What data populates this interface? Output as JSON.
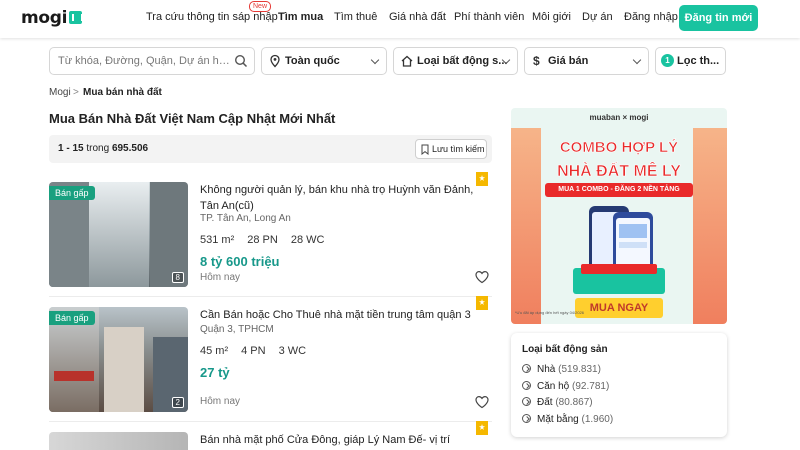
{
  "header": {
    "logo": "mogi",
    "nav": [
      {
        "label": "Tra cứu thông tin sáp nhập"
      },
      {
        "label": "Tìm mua"
      },
      {
        "label": "Tìm thuê"
      },
      {
        "label": "Giá nhà đất"
      },
      {
        "label": "Phí thành viên"
      },
      {
        "label": "Môi giới"
      },
      {
        "label": "Dự án"
      },
      {
        "label": "Đăng nhập"
      }
    ],
    "new_badge": "New",
    "post_button": "Đăng tin mới"
  },
  "search": {
    "placeholder": "Từ khóa, Đường, Quận, Dự án hoặc địa danh ...",
    "location": "Toàn quốc",
    "property_type": "Loại bất động s...",
    "price": "Giá bán",
    "filter_count": "1",
    "filter_label": "Lọc th..."
  },
  "breadcrumb": {
    "home": "Mogi",
    "separator": ">",
    "current": "Mua bán nhà đất"
  },
  "page_title": "Mua Bán Nhà Đất Việt Nam Cập Nhật Mới Nhất",
  "results": {
    "range": "1 - 15",
    "connector": "trong",
    "total": "695.506",
    "save_search": "Lưu tìm kiếm"
  },
  "listings": [
    {
      "tag": "Bán gấp",
      "image_count": "8",
      "title": "Không người quản lý, bán khu nhà trọ Huỳnh văn Đảnh, Tân An(cũ)",
      "location": "TP. Tân An, Long An",
      "area": "531 m²",
      "bedrooms": "28 PN",
      "bathrooms": "28 WC",
      "price": "8 tỷ 600 triệu",
      "date": "Hôm nay"
    },
    {
      "tag": "Bán gấp",
      "image_count": "2",
      "title": "Cần Bán hoặc Cho Thuê nhà mặt tiền trung tâm quận 3",
      "location": "Quận 3, TPHCM",
      "area": "45 m²",
      "bedrooms": "4 PN",
      "bathrooms": "3 WC",
      "price": "27 tỷ",
      "date": "Hôm nay"
    },
    {
      "title": "Bán nhà mặt phố Cửa Đông, giáp Lý Nam Đế- vị trí trung tâm"
    }
  ],
  "ad": {
    "brands": "muaban × mogi",
    "headline_1": "COMBO HỢP LÝ",
    "headline_2": "NHÀ ĐẤT MÊ LY",
    "banner": "MUA 1 COMBO - ĐĂNG 2 NỀN TẢNG",
    "cta": "MUA NGAY",
    "fine_print": "*Ưu đãi áp dụng đến hết ngày 04/2026"
  },
  "property_types": {
    "title": "Loại bất động sản",
    "items": [
      {
        "label": "Nhà",
        "count": "(519.831)"
      },
      {
        "label": "Căn hộ",
        "count": "(92.781)"
      },
      {
        "label": "Đất",
        "count": "(80.867)"
      },
      {
        "label": "Mặt bằng",
        "count": "(1.960)"
      }
    ]
  },
  "colors": {
    "brand": "#19c3a0",
    "price": "#17988a",
    "badge": "#e53935",
    "star": "#f5b800"
  }
}
